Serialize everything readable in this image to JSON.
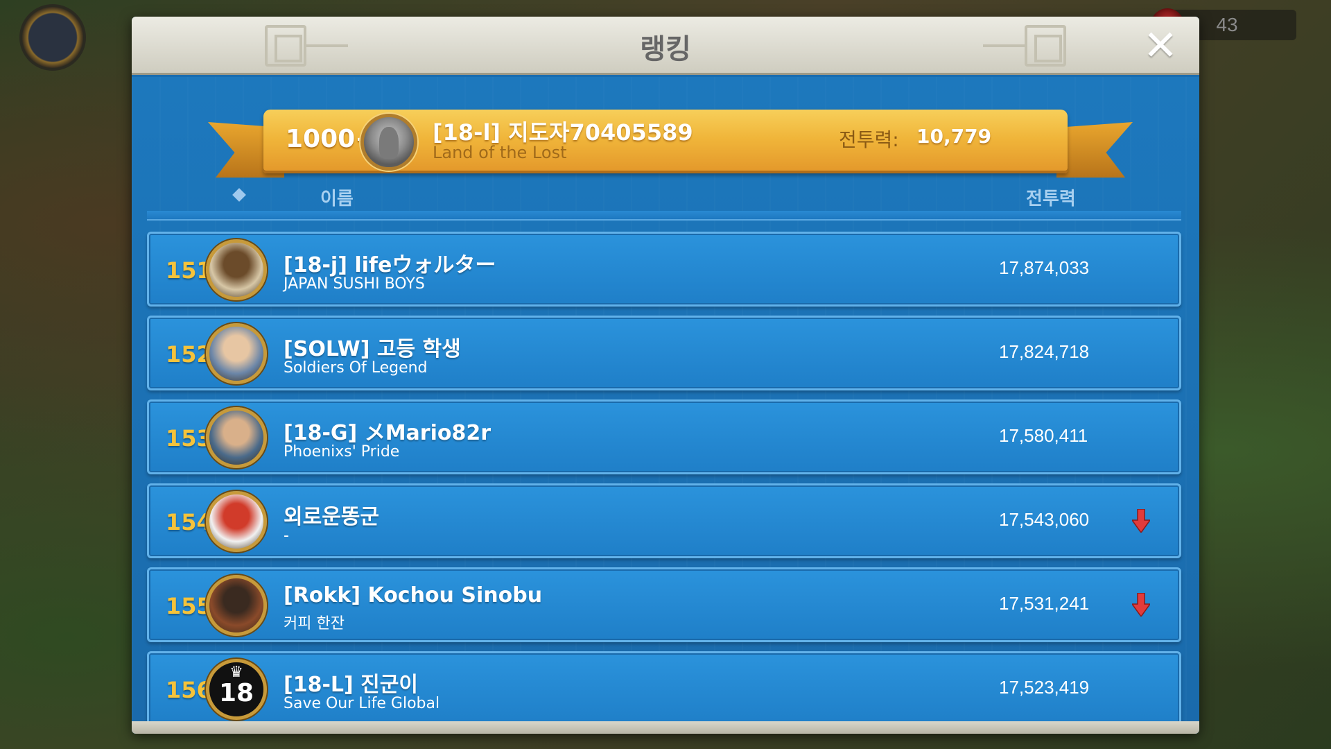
{
  "hud": {
    "counter": "43"
  },
  "panel": {
    "title": "랭킹"
  },
  "my_rank": {
    "rank": "1000+",
    "name": "[18-l] 지도자70405589",
    "alliance": "Land of the Lost",
    "power_label": "전투력:",
    "power": "10,779"
  },
  "columns": {
    "name": "이름",
    "power": "전투력"
  },
  "rows": [
    {
      "rank": "151",
      "name": "[18-j] lifeウォルター",
      "alliance": "JAPAN SUSHI BOYS",
      "power": "17,874,033",
      "trend": "none",
      "avatar": "life-emblem-avatar",
      "avatar_colors": [
        "#d7c7a6",
        "#6b4b2a"
      ]
    },
    {
      "rank": "152",
      "name": "[SOLW] 고등 학생",
      "alliance": "Soldiers Of Legend",
      "power": "17,824,718",
      "trend": "none",
      "avatar": "commander-portrait-avatar",
      "avatar_colors": [
        "#6b86a8",
        "#e7c6a3"
      ]
    },
    {
      "rank": "153",
      "name": "[18-G] メMario82r",
      "alliance": "Phoenixs' Pride",
      "power": "17,580,411",
      "trend": "none",
      "avatar": "commander-portrait-avatar",
      "avatar_colors": [
        "#4a6a8a",
        "#d9b08a"
      ]
    },
    {
      "rank": "154",
      "name": "외로운똥군",
      "alliance": "-",
      "power": "17,543,060",
      "trend": "down",
      "avatar": "cartoon-panda-avatar",
      "avatar_colors": [
        "#f1f1f1",
        "#d13b2a"
      ]
    },
    {
      "rank": "155",
      "name": "[Rokk] Kochou Sinobu",
      "alliance": "커피 한잔",
      "power": "17,531,241",
      "trend": "down",
      "avatar": "hooded-figure-avatar",
      "avatar_colors": [
        "#8a4a2a",
        "#3a2a20"
      ]
    },
    {
      "rank": "156",
      "name": "[18-L] 진군이",
      "alliance": "Save Our Life Global",
      "power": "17,523,419",
      "trend": "none",
      "avatar": "crown-18-badge-avatar",
      "avatar_colors": [
        "#111111",
        "#ffffff"
      ],
      "badge_text": "18"
    }
  ],
  "colors": {
    "panel_blue": "#1a6db0",
    "row_blue": "#2b93dc",
    "rank_gold": "#f5c33b",
    "ribbon_gold": "#f0b53a",
    "trend_down": "#e23b3b"
  }
}
